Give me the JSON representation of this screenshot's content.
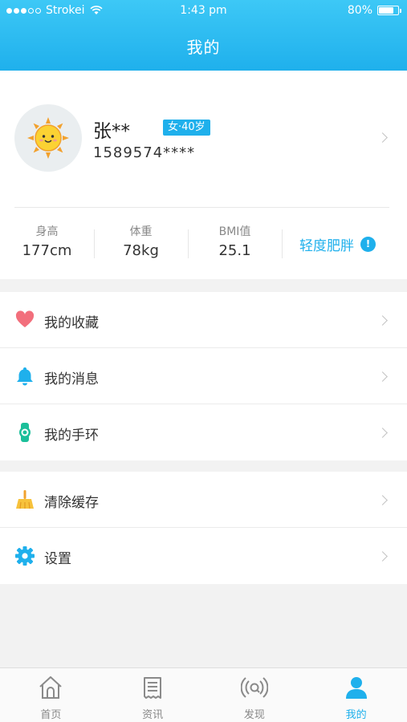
{
  "status_bar": {
    "carrier": "Strokei",
    "time": "1:43 pm",
    "battery": "80%",
    "battery_level": 0.8
  },
  "header": {
    "title": "我的"
  },
  "profile": {
    "name": "张**",
    "badge": "女·40岁",
    "phone": "1589574****"
  },
  "stats": [
    {
      "label": "身高",
      "value": "177cm"
    },
    {
      "label": "体重",
      "value": "78kg"
    },
    {
      "label": "BMI值",
      "value": "25.1"
    }
  ],
  "bmi_status": "轻度肥胖",
  "menu_group_1": [
    {
      "label": "我的收藏",
      "icon": "heart-icon"
    },
    {
      "label": "我的消息",
      "icon": "bell-icon"
    },
    {
      "label": "我的手环",
      "icon": "wristband-icon"
    }
  ],
  "menu_group_2": [
    {
      "label": "清除缓存",
      "icon": "broom-icon"
    },
    {
      "label": "设置",
      "icon": "gear-icon"
    }
  ],
  "tabs": [
    {
      "label": "首页",
      "icon": "home-icon"
    },
    {
      "label": "资讯",
      "icon": "news-icon"
    },
    {
      "label": "发现",
      "icon": "discover-icon"
    },
    {
      "label": "我的",
      "icon": "user-icon",
      "active": true
    }
  ],
  "colors": {
    "accent": "#1fb0ec",
    "background": "#f2f2f2"
  }
}
